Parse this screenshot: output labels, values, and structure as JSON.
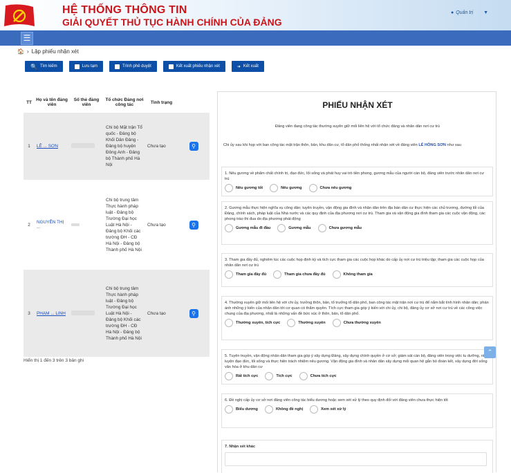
{
  "header": {
    "title_line1": "HỆ THỐNG THÔNG TIN",
    "title_line2": "GIẢI QUYẾT THỦ TỤC HÀNH CHÍNH CỦA ĐẢNG",
    "user_label": "Quản trị",
    "brand_color": "#c8161d"
  },
  "menubar": {
    "menu_icon": "hamburger-icon"
  },
  "breadcrumb": {
    "sep": "›",
    "current": "Lập phiếu nhận xét"
  },
  "toolbar": {
    "search": "Tìm kiếm",
    "save": "Lưu tạm",
    "submit": "Trình phê duyệt",
    "export_form": "Kết xuất phiếu nhận xét",
    "export": "Kết xuất"
  },
  "table": {
    "headers": {
      "tt": "TT",
      "name": "Họ và tên đảng viên",
      "card": "Số thẻ đảng viên",
      "org": "Tổ chức Đảng nơi công tác",
      "status": "Tình trạng"
    },
    "rows": [
      {
        "tt": "1",
        "name": "LÊ ... SƠN",
        "card": "",
        "org": "Chi bộ Mặt trận Tổ quốc - Đảng bộ Khối Dân Đảng - Đảng bộ huyện Đông Anh - Đảng bộ Thành phố Hà Nội",
        "status": "Chưa tạo"
      },
      {
        "tt": "2",
        "name": "NGUYỄN THỊ ...",
        "card": "",
        "org": "Chi bộ trung tâm Thực hành pháp luật - Đảng bộ Trường Đại học Luật Hà Nội - Đảng bộ Khối các trường ĐH - CĐ Hà Nội - Đảng bộ Thành phố Hà Nội",
        "status": "Chưa tạo"
      },
      {
        "tt": "3",
        "name": "PHẠM ... LINH",
        "card": "",
        "org": "Chi bộ trung tâm Thực hành pháp luật - Đảng bộ Trường Đại học Luật Hà Nội - Đảng bộ Khối các trường ĐH - CĐ Hà Nội - Đảng bộ Thành phố Hà Nội",
        "status": "Chưa tạo"
      }
    ],
    "footer": "Hiển thị 1 đến 3 trên 3 bản ghi"
  },
  "form": {
    "title": "PHIẾU NHẬN XÉT",
    "subtitle": "Đảng viên đang công tác thường xuyên giữ mối liên hệ với tổ chức đảng và nhân dân nơi cư trú",
    "intro_prefix": "Chi ủy sau khi họp với ban công tác mặt trận thôn, bản, khu dân cư, tổ dân phố thống nhất nhận xét về đảng viên",
    "intro_name": "LÊ HỒNG SƠN",
    "intro_suffix": "như sau",
    "questions": [
      {
        "text": "1. Nêu gương về phẩm chất chính trị, đạo đức, lối sống và phát huy vai trò tiền phong, gương mẫu của người cán bộ, đảng viên trước nhân dân nơi cư trú",
        "options": [
          "Nêu gương tốt",
          "Nêu gương",
          "Chưa nêu gương"
        ]
      },
      {
        "text": "2. Gương mẫu thực hiện nghĩa vụ công dân; tuyên truyền, vận động gia đình và nhân dân trên địa bàn dân cư thực hiện các chủ trương, đường lối của Đảng, chính sách, pháp luật của Nhà nước và các quy định của địa phương nơi cư trú. Tham gia và vận động gia đình tham gia các cuộc vận động, các phong trào thi đua do địa phương phát động",
        "options": [
          "Gương mẫu đi đầu",
          "Gương mẫu",
          "Chưa gương mẫu"
        ]
      },
      {
        "text": "3. Tham gia đầy đủ, nghiêm túc các cuộc họp định kỳ và tích cực tham gia các cuộc họp khác do cấp ủy nơi cư trú triệu tập; tham gia các cuộc họp của nhân dân nơi cư trú",
        "options": [
          "Tham gia đầy đủ",
          "Tham gia chưa đầy đủ",
          "Không tham gia"
        ]
      },
      {
        "text": "4. Thường xuyên giữ mối liên hệ với chi ủy, trưởng thôn, bản, tổ trưởng tổ dân phố, ban công tác mặt trận nơi cư trú để nắm bắt tình hình nhân dân; phản ánh những ý kiến của nhân dân tới cơ quan có thẩm quyền. Tích cực tham gia góp ý kiến với chi ủy, chi bộ, đảng ủy cơ sở nơi cư trú về các công việc chung của địa phương, nhất là những vấn đề bức xúc ở thôn, bản, tổ dân phố.",
        "options": [
          "Thường xuyên, tích cực",
          "Thường xuyên",
          "Chưa thường xuyên"
        ]
      },
      {
        "text": "5. Tuyên truyền, vận động nhân dân tham gia góp ý xây dựng Đảng, xây dựng chính quyền ở cơ sở; giám sát cán bộ, đảng viên trong việc tu dưỡng, rèn luyện đạo đức, lối sống và thực hiện trách nhiệm nêu gương. Vận động gia đình và nhân dân xây dựng mối quan hệ gắn bó đoàn kết, xây dựng đời sống văn hóa ở khu dân cư",
        "options": [
          "Rất tích cực",
          "Tích cực",
          "Chưa tích cực"
        ]
      },
      {
        "text": "6. Đề nghị cấp ủy cơ sở nơi đảng viên công tác biểu dương hoặc xem xét xử lý theo quy định đối với đảng viên chưa thực hiện tốt",
        "options": [
          "Biểu dương",
          "Không đề nghị",
          "Xem xét xử lý"
        ]
      }
    ],
    "q7": "7. Nhận xét khác"
  }
}
